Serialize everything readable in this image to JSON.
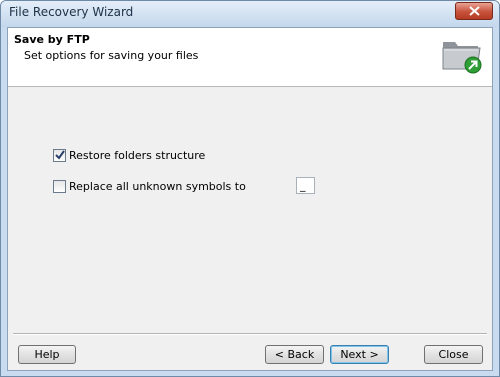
{
  "window": {
    "title": "File Recovery Wizard"
  },
  "header": {
    "title": "Save by FTP",
    "subtitle": "Set options for saving your files",
    "icon": "folder-export-icon"
  },
  "options": {
    "restore_folders": {
      "label": "Restore folders structure",
      "checked": true
    },
    "replace_unknown": {
      "label": "Replace all unknown symbols to",
      "checked": false,
      "value": "_"
    }
  },
  "buttons": {
    "help": "Help",
    "back": "< Back",
    "next": "Next >",
    "close": "Close"
  }
}
